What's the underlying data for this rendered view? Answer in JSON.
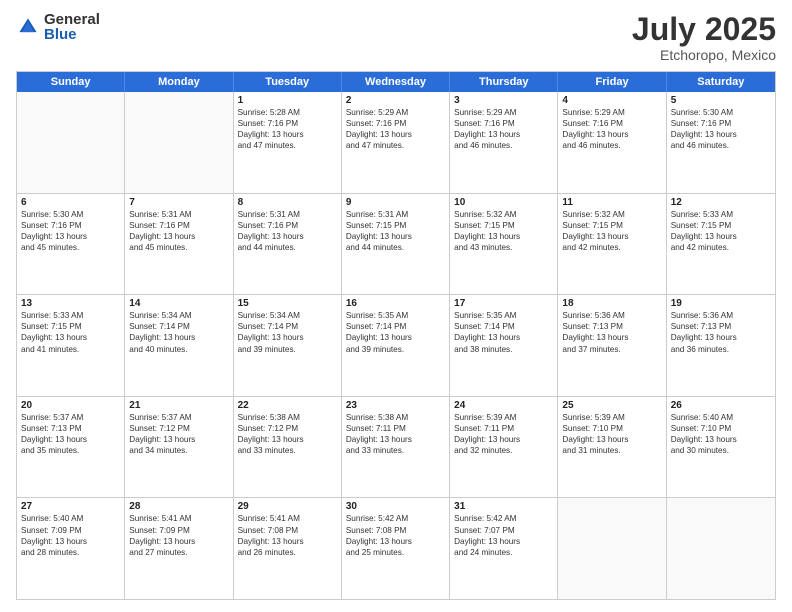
{
  "header": {
    "logo_general": "General",
    "logo_blue": "Blue",
    "title": "July 2025",
    "subtitle": "Etchoropo, Mexico"
  },
  "days_of_week": [
    "Sunday",
    "Monday",
    "Tuesday",
    "Wednesday",
    "Thursday",
    "Friday",
    "Saturday"
  ],
  "weeks": [
    [
      {
        "day": null,
        "lines": []
      },
      {
        "day": null,
        "lines": []
      },
      {
        "day": "1",
        "lines": [
          "Sunrise: 5:28 AM",
          "Sunset: 7:16 PM",
          "Daylight: 13 hours",
          "and 47 minutes."
        ]
      },
      {
        "day": "2",
        "lines": [
          "Sunrise: 5:29 AM",
          "Sunset: 7:16 PM",
          "Daylight: 13 hours",
          "and 47 minutes."
        ]
      },
      {
        "day": "3",
        "lines": [
          "Sunrise: 5:29 AM",
          "Sunset: 7:16 PM",
          "Daylight: 13 hours",
          "and 46 minutes."
        ]
      },
      {
        "day": "4",
        "lines": [
          "Sunrise: 5:29 AM",
          "Sunset: 7:16 PM",
          "Daylight: 13 hours",
          "and 46 minutes."
        ]
      },
      {
        "day": "5",
        "lines": [
          "Sunrise: 5:30 AM",
          "Sunset: 7:16 PM",
          "Daylight: 13 hours",
          "and 46 minutes."
        ]
      }
    ],
    [
      {
        "day": "6",
        "lines": [
          "Sunrise: 5:30 AM",
          "Sunset: 7:16 PM",
          "Daylight: 13 hours",
          "and 45 minutes."
        ]
      },
      {
        "day": "7",
        "lines": [
          "Sunrise: 5:31 AM",
          "Sunset: 7:16 PM",
          "Daylight: 13 hours",
          "and 45 minutes."
        ]
      },
      {
        "day": "8",
        "lines": [
          "Sunrise: 5:31 AM",
          "Sunset: 7:16 PM",
          "Daylight: 13 hours",
          "and 44 minutes."
        ]
      },
      {
        "day": "9",
        "lines": [
          "Sunrise: 5:31 AM",
          "Sunset: 7:15 PM",
          "Daylight: 13 hours",
          "and 44 minutes."
        ]
      },
      {
        "day": "10",
        "lines": [
          "Sunrise: 5:32 AM",
          "Sunset: 7:15 PM",
          "Daylight: 13 hours",
          "and 43 minutes."
        ]
      },
      {
        "day": "11",
        "lines": [
          "Sunrise: 5:32 AM",
          "Sunset: 7:15 PM",
          "Daylight: 13 hours",
          "and 42 minutes."
        ]
      },
      {
        "day": "12",
        "lines": [
          "Sunrise: 5:33 AM",
          "Sunset: 7:15 PM",
          "Daylight: 13 hours",
          "and 42 minutes."
        ]
      }
    ],
    [
      {
        "day": "13",
        "lines": [
          "Sunrise: 5:33 AM",
          "Sunset: 7:15 PM",
          "Daylight: 13 hours",
          "and 41 minutes."
        ]
      },
      {
        "day": "14",
        "lines": [
          "Sunrise: 5:34 AM",
          "Sunset: 7:14 PM",
          "Daylight: 13 hours",
          "and 40 minutes."
        ]
      },
      {
        "day": "15",
        "lines": [
          "Sunrise: 5:34 AM",
          "Sunset: 7:14 PM",
          "Daylight: 13 hours",
          "and 39 minutes."
        ]
      },
      {
        "day": "16",
        "lines": [
          "Sunrise: 5:35 AM",
          "Sunset: 7:14 PM",
          "Daylight: 13 hours",
          "and 39 minutes."
        ]
      },
      {
        "day": "17",
        "lines": [
          "Sunrise: 5:35 AM",
          "Sunset: 7:14 PM",
          "Daylight: 13 hours",
          "and 38 minutes."
        ]
      },
      {
        "day": "18",
        "lines": [
          "Sunrise: 5:36 AM",
          "Sunset: 7:13 PM",
          "Daylight: 13 hours",
          "and 37 minutes."
        ]
      },
      {
        "day": "19",
        "lines": [
          "Sunrise: 5:36 AM",
          "Sunset: 7:13 PM",
          "Daylight: 13 hours",
          "and 36 minutes."
        ]
      }
    ],
    [
      {
        "day": "20",
        "lines": [
          "Sunrise: 5:37 AM",
          "Sunset: 7:13 PM",
          "Daylight: 13 hours",
          "and 35 minutes."
        ]
      },
      {
        "day": "21",
        "lines": [
          "Sunrise: 5:37 AM",
          "Sunset: 7:12 PM",
          "Daylight: 13 hours",
          "and 34 minutes."
        ]
      },
      {
        "day": "22",
        "lines": [
          "Sunrise: 5:38 AM",
          "Sunset: 7:12 PM",
          "Daylight: 13 hours",
          "and 33 minutes."
        ]
      },
      {
        "day": "23",
        "lines": [
          "Sunrise: 5:38 AM",
          "Sunset: 7:11 PM",
          "Daylight: 13 hours",
          "and 33 minutes."
        ]
      },
      {
        "day": "24",
        "lines": [
          "Sunrise: 5:39 AM",
          "Sunset: 7:11 PM",
          "Daylight: 13 hours",
          "and 32 minutes."
        ]
      },
      {
        "day": "25",
        "lines": [
          "Sunrise: 5:39 AM",
          "Sunset: 7:10 PM",
          "Daylight: 13 hours",
          "and 31 minutes."
        ]
      },
      {
        "day": "26",
        "lines": [
          "Sunrise: 5:40 AM",
          "Sunset: 7:10 PM",
          "Daylight: 13 hours",
          "and 30 minutes."
        ]
      }
    ],
    [
      {
        "day": "27",
        "lines": [
          "Sunrise: 5:40 AM",
          "Sunset: 7:09 PM",
          "Daylight: 13 hours",
          "and 28 minutes."
        ]
      },
      {
        "day": "28",
        "lines": [
          "Sunrise: 5:41 AM",
          "Sunset: 7:09 PM",
          "Daylight: 13 hours",
          "and 27 minutes."
        ]
      },
      {
        "day": "29",
        "lines": [
          "Sunrise: 5:41 AM",
          "Sunset: 7:08 PM",
          "Daylight: 13 hours",
          "and 26 minutes."
        ]
      },
      {
        "day": "30",
        "lines": [
          "Sunrise: 5:42 AM",
          "Sunset: 7:08 PM",
          "Daylight: 13 hours",
          "and 25 minutes."
        ]
      },
      {
        "day": "31",
        "lines": [
          "Sunrise: 5:42 AM",
          "Sunset: 7:07 PM",
          "Daylight: 13 hours",
          "and 24 minutes."
        ]
      },
      {
        "day": null,
        "lines": []
      },
      {
        "day": null,
        "lines": []
      }
    ]
  ]
}
